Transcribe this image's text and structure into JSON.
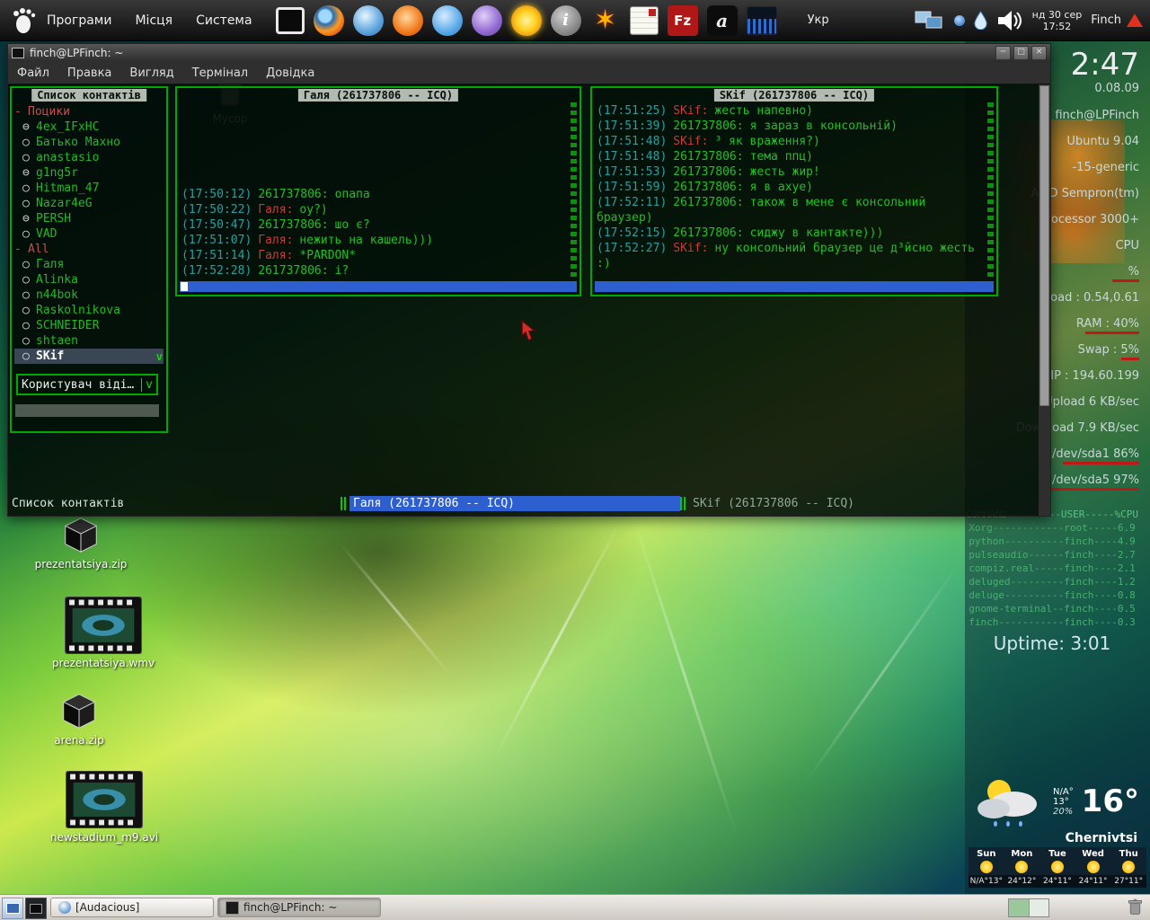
{
  "top_panel": {
    "menus": [
      {
        "label": "Програми"
      },
      {
        "label": "Місця"
      },
      {
        "label": "Система"
      }
    ],
    "glyphs": {
      "info": "i",
      "burst": "✶",
      "filezilla": "Fz",
      "audacious": "a"
    },
    "keyboard_layout": "Укр",
    "clock_date": "нд 30 сер",
    "clock_time": "17:52",
    "notification_label": "Finch"
  },
  "terminal": {
    "title": "finch@LPFinch: ~",
    "menu_items": [
      {
        "label": "Файл"
      },
      {
        "label": "Правка"
      },
      {
        "label": "Вигляд"
      },
      {
        "label": "Термінал"
      },
      {
        "label": "Довідка"
      }
    ],
    "window_buttons": [
      {
        "name": "minimize-button",
        "glyph": "─"
      },
      {
        "name": "maximize-button",
        "glyph": "□"
      },
      {
        "name": "close-button",
        "glyph": "✕"
      }
    ]
  },
  "buddy_list": {
    "title": "Список контактів",
    "items": [
      {
        "cls": "group",
        "icon": "-",
        "name": "Поцики"
      },
      {
        "cls": "buddy",
        "icon": "⊖",
        "name": "4ex_IFxHC"
      },
      {
        "cls": "buddy",
        "icon": "○",
        "name": "Батько Махно"
      },
      {
        "cls": "buddy",
        "icon": "○",
        "name": "anastasio"
      },
      {
        "cls": "buddy",
        "icon": "⊖",
        "name": "g1ng5r"
      },
      {
        "cls": "buddy",
        "icon": "○",
        "name": "Hitman_47"
      },
      {
        "cls": "buddy",
        "icon": "○",
        "name": "Nazar4eG"
      },
      {
        "cls": "buddy",
        "icon": "⊖",
        "name": "PERSH"
      },
      {
        "cls": "buddy",
        "icon": "○",
        "name": "VAD"
      },
      {
        "cls": "group",
        "icon": "-",
        "name": "All"
      },
      {
        "cls": "buddy",
        "icon": "○",
        "name": "Галя"
      },
      {
        "cls": "buddy",
        "icon": "○",
        "name": "Alinka"
      },
      {
        "cls": "buddy",
        "icon": "○",
        "name": "n44bok"
      },
      {
        "cls": "buddy",
        "icon": "○",
        "name": "Raskolnikova"
      },
      {
        "cls": "buddy",
        "icon": "○",
        "name": "SCHNEIDER"
      },
      {
        "cls": "buddy",
        "icon": "○",
        "name": "shtaen"
      },
      {
        "cls": "selected",
        "icon": "○",
        "name": "SKif"
      }
    ],
    "scroll_indicator": "v",
    "status_dropdown": "Користувач віді…",
    "dropdown_arrow": "v"
  },
  "chat_galya": {
    "title": "Галя (261737806 -- ICQ)",
    "lines": [
      {
        "cls": "self",
        "time": "(17:50:12)",
        "nick": "261737806:",
        "text": "опапа"
      },
      {
        "cls": "peer",
        "time": "(17:50:22)",
        "nick": "Галя:",
        "text": "оу?)"
      },
      {
        "cls": "self",
        "time": "(17:50:47)",
        "nick": "261737806:",
        "text": "шо є?"
      },
      {
        "cls": "peer",
        "time": "(17:51:07)",
        "nick": "Галя:",
        "text": "нежить на кашель)))"
      },
      {
        "cls": "peer",
        "time": "(17:51:14)",
        "nick": "Галя:",
        "text": "*PARDON*"
      },
      {
        "cls": "self",
        "time": "(17:52:28)",
        "nick": "261737806:",
        "text": "і?"
      }
    ]
  },
  "chat_skif": {
    "title": "SKif (261737806 -- ICQ)",
    "lines": [
      {
        "cls": "peer",
        "time": "(17:51:25)",
        "nick": "SKif:",
        "text": "жесть напевно)"
      },
      {
        "cls": "self",
        "time": "(17:51:39)",
        "nick": "261737806:",
        "text": "я зараз в консольній)"
      },
      {
        "cls": "peer",
        "time": "(17:51:48)",
        "nick": "SKif:",
        "text": "³ як враження?)"
      },
      {
        "cls": "self",
        "time": "(17:51:48)",
        "nick": "261737806:",
        "text": "тема ппц)"
      },
      {
        "cls": "self",
        "time": "(17:51:53)",
        "nick": "261737806:",
        "text": "жесть жир!"
      },
      {
        "cls": "self",
        "time": "(17:51:59)",
        "nick": "261737806:",
        "text": "я в ахуе)"
      },
      {
        "cls": "self",
        "time": "(17:52:11)",
        "nick": "261737806:",
        "text": "також в мене є консольний"
      },
      {
        "cls": "cont",
        "time": "",
        "nick": "",
        "text": "браузер)"
      },
      {
        "cls": "self",
        "time": "(17:52:15)",
        "nick": "261737806:",
        "text": "сиджу в кантакте)))"
      },
      {
        "cls": "peer",
        "time": "(17:52:27)",
        "nick": "SKif:",
        "text": "ну консольний браузер це д³йсно жесть"
      },
      {
        "cls": "cont",
        "time": "",
        "nick": "",
        "text": ":)"
      }
    ]
  },
  "finch_taskbar": {
    "buddy_list_label": "Список контактів",
    "windows": [
      {
        "cls": "active",
        "label": "Галя (261737806 -- ICQ)"
      },
      {
        "cls": "inactive",
        "label": "SKif (261737806 -- ICQ)"
      }
    ]
  },
  "desktop": {
    "icons": [
      {
        "label": "Мусор",
        "cls": "trash ghost"
      },
      {
        "label": "prezentatsiya.zip",
        "cls": "archive pz"
      },
      {
        "label": "prezentatsiya.wmv",
        "cls": "video pw"
      },
      {
        "label": "arena.zip",
        "cls": "archive az"
      },
      {
        "label": "newstadium_m9.avi",
        "cls": "video ns"
      }
    ]
  },
  "system_monitor": {
    "time_big": "2:47",
    "date": "0.08.09",
    "rows": [
      {
        "text": "finch@LPFinch"
      },
      {
        "text": "Ubuntu 9.04"
      },
      {
        "text": "-15-generic"
      },
      {
        "text": "AMD Sempron(tm)"
      },
      {
        "text": "Processor 3000+"
      },
      {
        "text": "CPU"
      },
      {
        "text": "%",
        "bar": "b30"
      },
      {
        "text": "Load : 0.54,0.61"
      },
      {
        "text": "RAM : 40%",
        "bar": "b60"
      },
      {
        "text": "Swap : 5%",
        "bar": "b20"
      },
      {
        "text": "IP : 194.60.199"
      },
      {
        "text": "Upload 6 KB/sec"
      },
      {
        "text": "Download 7.9 KB/sec"
      },
      {
        "text": "/dev/sda1 86%",
        "bar": "b85"
      },
      {
        "text": "/dev/sda5 97%",
        "bar": "b110"
      }
    ],
    "process_header": "COMMAND---------USER-----%CPU",
    "processes": [
      "Xorg------------root-----6.9",
      "python----------finch----4.9",
      "pulseaudio------finch----2.7",
      "compiz.real-----finch----2.1",
      "deluged---------finch----1.2",
      "deluge----------finch----0.8",
      "gnome-terminal--finch----0.5",
      "finch-----------finch----0.3"
    ],
    "uptime": "Uptime: 3:01"
  },
  "weather": {
    "na_temp": "N/A°",
    "low_temp": "13°",
    "humidity": "20%",
    "current_temp": "16°",
    "city": "Chernivtsi",
    "forecast": [
      {
        "day": "Sun",
        "temps": "N/A°13°"
      },
      {
        "day": "Mon",
        "temps": "24°12°"
      },
      {
        "day": "Tue",
        "temps": "24°11°"
      },
      {
        "day": "Wed",
        "temps": "24°11°"
      },
      {
        "day": "Thu",
        "temps": "27°11°"
      }
    ]
  },
  "bottom_bar": {
    "tasks": [
      {
        "cls": "normal",
        "icon": "audacious-task-icon",
        "label": "[Audacious]"
      },
      {
        "cls": "active",
        "icon": "terminal-task-icon",
        "label": "finch@LPFinch: ~"
      }
    ]
  }
}
